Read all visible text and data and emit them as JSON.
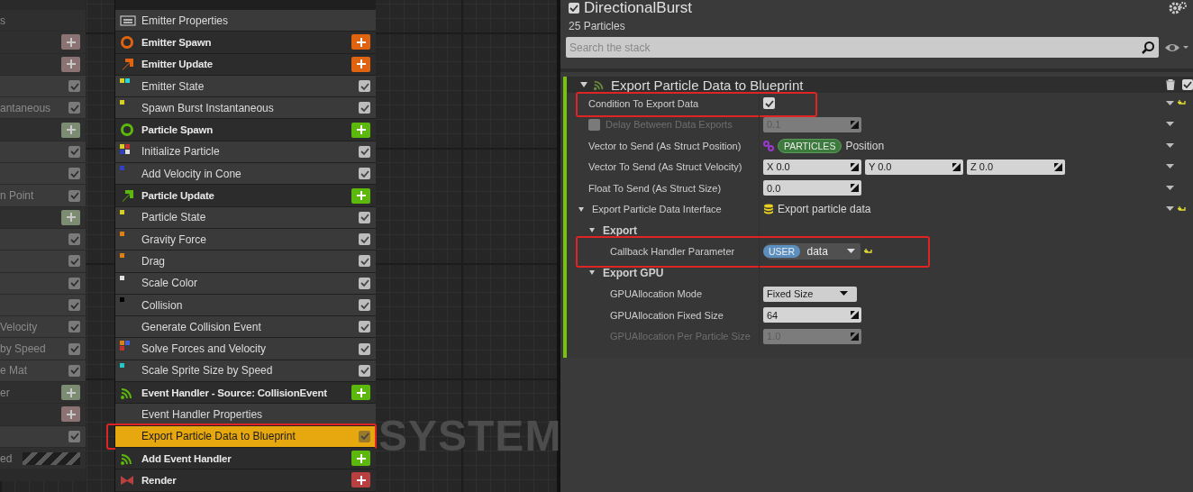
{
  "left_panel": {
    "rows": [
      {
        "kind": "plain",
        "text": "s"
      },
      {
        "kind": "add",
        "color": "#8c7373"
      },
      {
        "kind": "add",
        "color": "#8c7373"
      },
      {
        "kind": "check",
        "checked": true
      },
      {
        "kind": "check",
        "text": "antaneous",
        "checked": true
      },
      {
        "kind": "add",
        "color": "#7b8c73"
      },
      {
        "kind": "check",
        "checked": true
      },
      {
        "kind": "check",
        "checked": true
      },
      {
        "kind": "check",
        "text": "n Point",
        "checked": true
      },
      {
        "kind": "add",
        "color": "#7b8c73"
      },
      {
        "kind": "check",
        "checked": true
      },
      {
        "kind": "check",
        "checked": true
      },
      {
        "kind": "check",
        "checked": true
      },
      {
        "kind": "check",
        "checked": true
      },
      {
        "kind": "check",
        "text": "Velocity",
        "checked": true
      },
      {
        "kind": "check",
        "text": "by Speed",
        "checked": true
      },
      {
        "kind": "check",
        "text": "e Mat",
        "checked": true
      },
      {
        "kind": "add",
        "text": "er",
        "color": "#7b8c73"
      },
      {
        "kind": "add",
        "color": "#8c7373"
      },
      {
        "kind": "check",
        "checked": true
      },
      {
        "kind": "status",
        "text": "ed"
      }
    ]
  },
  "emitter_stack": {
    "rows": [
      {
        "kind": "properties",
        "label": "Emitter Properties",
        "selected": false,
        "highlighted": false
      },
      {
        "kind": "spawn",
        "label": "Emitter Spawn",
        "color": "#e0640f",
        "selected": false,
        "highlighted": false
      },
      {
        "kind": "update",
        "label": "Emitter Update",
        "color": "#e0640f",
        "selected": false,
        "highlighted": false
      },
      {
        "kind": "module",
        "label": "Emitter State",
        "markers": [
          {
            "color": "#d8d020"
          },
          {
            "color": "#20d8d8"
          }
        ],
        "checked": true,
        "selected": false,
        "highlighted": false
      },
      {
        "kind": "module",
        "label": "Spawn Burst Instantaneous",
        "markers": [
          {
            "color": "#d8d020"
          }
        ],
        "checked": true,
        "selected": false,
        "highlighted": false
      },
      {
        "kind": "spawn",
        "label": "Particle Spawn",
        "color": "#5cb80c",
        "selected": false,
        "highlighted": false
      },
      {
        "kind": "module",
        "label": "Initialize Particle",
        "markers": [
          {
            "color": "#d8d020"
          },
          {
            "color": "#c83030"
          },
          {
            "color": "#3040c8"
          },
          {
            "color": "#e0e0e0"
          }
        ],
        "checked": true,
        "selected": false,
        "highlighted": false
      },
      {
        "kind": "module",
        "label": "Add Velocity in Cone",
        "markers": [
          {
            "color": "#3040c8"
          }
        ],
        "checked": true,
        "selected": false,
        "highlighted": false
      },
      {
        "kind": "update",
        "label": "Particle Update",
        "color": "#5cb80c",
        "selected": false,
        "highlighted": false
      },
      {
        "kind": "module",
        "label": "Particle State",
        "markers": [
          {
            "color": "#d8d020"
          }
        ],
        "checked": true,
        "selected": false,
        "highlighted": false
      },
      {
        "kind": "module",
        "label": "Gravity Force",
        "markers": [
          {
            "color": "#e08010"
          }
        ],
        "checked": true,
        "selected": false,
        "highlighted": false
      },
      {
        "kind": "module",
        "label": "Drag",
        "markers": [
          {
            "color": "#e08010"
          }
        ],
        "checked": true,
        "selected": false,
        "highlighted": false
      },
      {
        "kind": "module",
        "label": "Scale Color",
        "markers": [
          {
            "color": "#e0e0e0"
          }
        ],
        "checked": true,
        "selected": false,
        "highlighted": false
      },
      {
        "kind": "module",
        "label": "Collision",
        "markers": [
          {
            "color": "#000000"
          }
        ],
        "checked": true,
        "selected": false,
        "highlighted": false
      },
      {
        "kind": "module",
        "label": "Generate Collision Event",
        "markers": [],
        "checked": true,
        "selected": false,
        "highlighted": false
      },
      {
        "kind": "module",
        "label": "Solve Forces and Velocity",
        "markers": [
          {
            "color": "#e08010"
          },
          {
            "color": "#4060e0"
          },
          {
            "color": "#c83030"
          }
        ],
        "checked": true,
        "selected": false,
        "highlighted": false
      },
      {
        "kind": "module",
        "label": "Scale Sprite Size by Speed",
        "markers": [
          {
            "color": "#20c8c8"
          }
        ],
        "checked": true,
        "selected": false,
        "highlighted": false
      },
      {
        "kind": "event",
        "label": "Event Handler - Source: CollisionEvent",
        "color": "#5cb80c",
        "selected": false,
        "highlighted": false
      },
      {
        "kind": "properties_plain",
        "label": "Event Handler Properties",
        "selected": false,
        "highlighted": false
      },
      {
        "kind": "module",
        "label": "Export Particle Data to Blueprint",
        "markers": [],
        "checked": true,
        "selected": true,
        "highlighted": true
      },
      {
        "kind": "event",
        "label": "Add Event Handler",
        "color": "#5cb80c",
        "selected": false,
        "highlighted": false
      },
      {
        "kind": "render",
        "label": "Render",
        "color": "#b84040",
        "selected": false,
        "highlighted": false
      }
    ]
  },
  "graph_label": "SYSTEM",
  "emitter": {
    "name": "DirectionalBurst",
    "enabled": true,
    "particle_count": "25 Particles"
  },
  "search": {
    "placeholder": "Search the stack"
  },
  "module": {
    "title": "Export Particle Data to Blueprint",
    "enabled": true,
    "properties": [
      {
        "kind": "checkbox",
        "label": "Condition To Export Data",
        "checked": true,
        "disabled": false,
        "menu": true,
        "reset": true,
        "highlighted": true
      },
      {
        "kind": "number",
        "label": "Delay Between Data Exports",
        "value": "0.1",
        "edit_condition": false,
        "disabled": true,
        "menu": true,
        "reset": false,
        "highlighted": false
      },
      {
        "kind": "binding",
        "label": "Vector to Send (As Struct Position)",
        "namespace": "PARTICLES",
        "value": "Position",
        "disabled": false,
        "menu": true,
        "reset": false,
        "highlighted": false
      },
      {
        "kind": "vector",
        "label": "Vector To Send (As Struct Velocity)",
        "components": [
          {
            "axis": "X",
            "value": "0.0"
          },
          {
            "axis": "Y",
            "value": "0.0"
          },
          {
            "axis": "Z",
            "value": "0.0"
          }
        ],
        "disabled": false,
        "menu": true,
        "reset": false,
        "highlighted": false
      },
      {
        "kind": "number",
        "label": "Float To Send (As Struct Size)",
        "value": "0.0",
        "disabled": false,
        "menu": true,
        "reset": false,
        "highlighted": false
      },
      {
        "kind": "object",
        "label": "Export Particle Data Interface",
        "value": "Export particle data",
        "expanded": true,
        "disabled": false,
        "menu": true,
        "reset": true,
        "highlighted": false,
        "children": [
          {
            "kind": "section",
            "label": "Export",
            "expanded": true,
            "disabled": false,
            "menu": false,
            "reset": false,
            "highlighted": false,
            "children": [
              {
                "kind": "user_param",
                "label": "Callback Handler Parameter",
                "namespace": "USER",
                "value": "data",
                "disabled": false,
                "menu": false,
                "reset": true,
                "highlighted": true
              }
            ]
          },
          {
            "kind": "section",
            "label": "Export GPU",
            "expanded": true,
            "disabled": false,
            "menu": false,
            "reset": false,
            "highlighted": false,
            "children": [
              {
                "kind": "dropdown",
                "label": "GPUAllocation Mode",
                "value": "Fixed Size",
                "disabled": false,
                "menu": false,
                "reset": false,
                "highlighted": false
              },
              {
                "kind": "number",
                "label": "GPUAllocation Fixed Size",
                "value": "64",
                "disabled": false,
                "menu": false,
                "reset": false,
                "highlighted": false
              },
              {
                "kind": "number",
                "label": "GPUAllocation Per Particle Size",
                "value": "1.0",
                "disabled": true,
                "menu": false,
                "reset": false,
                "highlighted": false
              }
            ]
          }
        ]
      }
    ]
  }
}
